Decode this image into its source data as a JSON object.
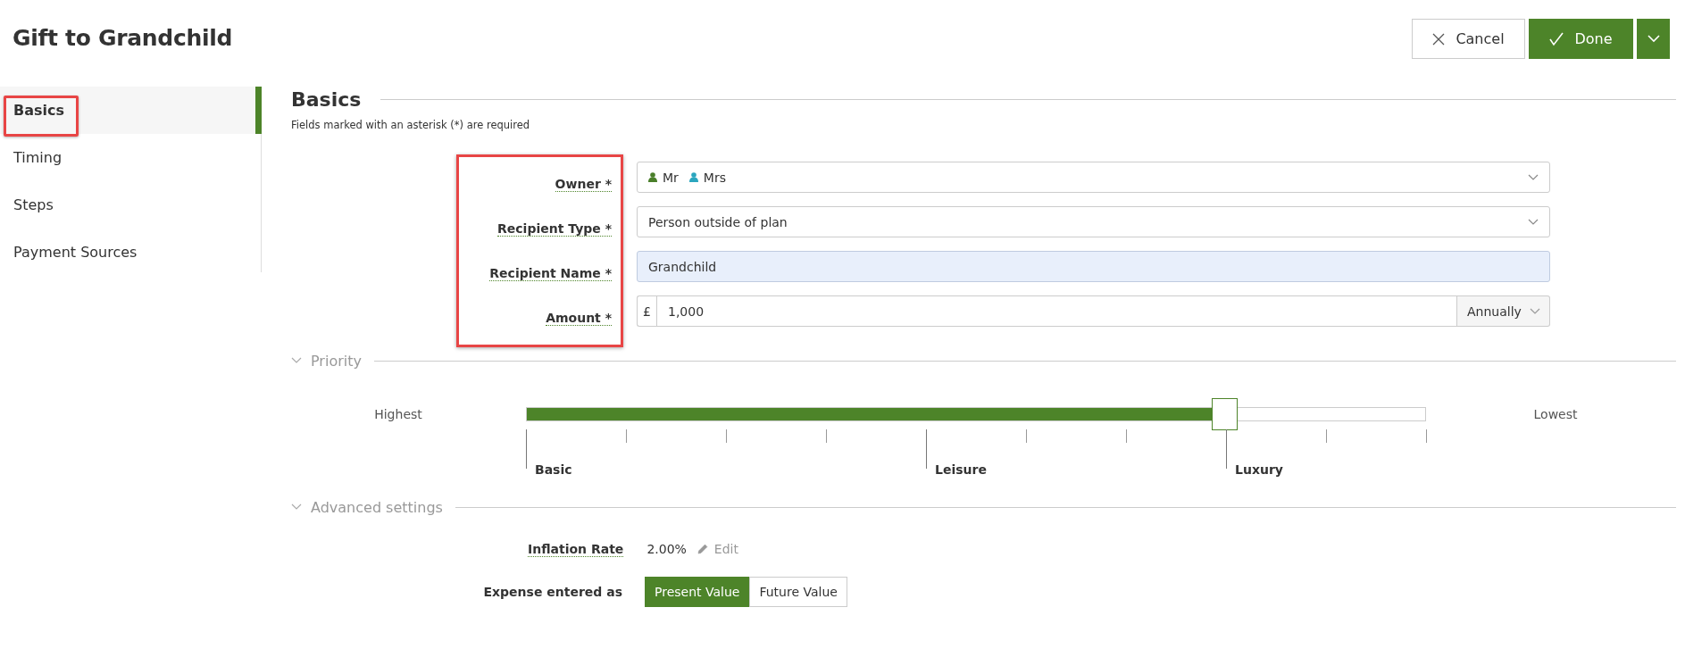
{
  "page": {
    "title": "Gift to Grandchild"
  },
  "actions": {
    "cancel": "Cancel",
    "done": "Done"
  },
  "sidebar": {
    "items": [
      {
        "label": "Basics",
        "selected": true,
        "highlighted": true
      },
      {
        "label": "Timing",
        "selected": false,
        "highlighted": false
      },
      {
        "label": "Steps",
        "selected": false,
        "highlighted": false
      },
      {
        "label": "Payment Sources",
        "selected": false,
        "highlighted": false
      }
    ]
  },
  "basics": {
    "heading": "Basics",
    "note": "Fields marked with an asterisk (*) are required",
    "labels_highlighted": true,
    "fields": [
      {
        "kind": "owners",
        "label": "Owner *",
        "owners": [
          {
            "name": "Mr",
            "color": "#4a7f2a"
          },
          {
            "name": "Mrs",
            "color": "#2ba6bf"
          }
        ]
      },
      {
        "kind": "select",
        "label": "Recipient Type *",
        "value": "Person outside of plan"
      },
      {
        "kind": "text",
        "label": "Recipient Name *",
        "value": "Grandchild"
      },
      {
        "kind": "amount",
        "label": "Amount *",
        "prefix": "£",
        "value": "1,000",
        "frequency": "Annually"
      }
    ]
  },
  "priority": {
    "heading": "Priority",
    "expanded": true,
    "start_label": "Highest",
    "end_label": "Lowest",
    "level": 0.777,
    "marks": [
      {
        "label": "Basic"
      },
      {
        "label": "Leisure"
      },
      {
        "label": "Luxury"
      }
    ]
  },
  "advanced": {
    "heading": "Advanced settings",
    "expanded": true,
    "inflation": {
      "label": "Inflation Rate",
      "value": "2.00%",
      "edit": "Edit"
    },
    "expense": {
      "label": "Expense entered as",
      "options": [
        {
          "label": "Present Value",
          "selected": true
        },
        {
          "label": "Future Value",
          "selected": false
        }
      ]
    }
  }
}
